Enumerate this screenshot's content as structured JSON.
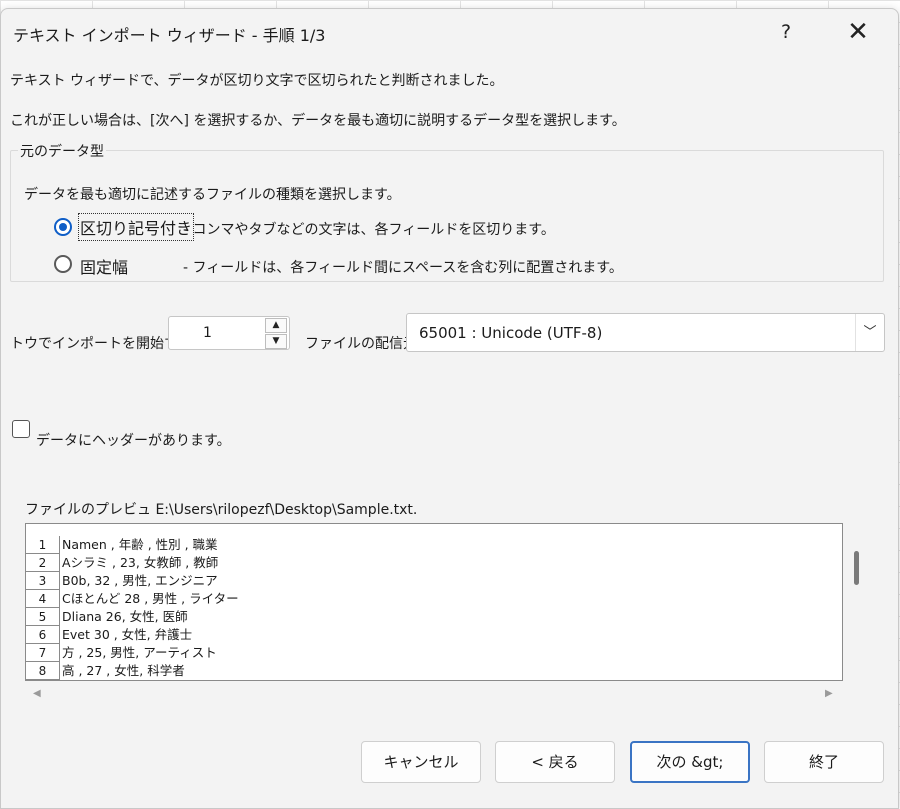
{
  "window": {
    "title": "テキスト インポート ウィザード - 手順 1/3",
    "help_label": "?",
    "close_label": "✕"
  },
  "intro": {
    "line1": "テキスト ウィザードで、データが区切り文字で区切られたと判断されました。",
    "line2": "これが正しい場合は、[次へ] を選択するか、データを最も適切に説明するデータ型を選択します。"
  },
  "original_data_type": {
    "group_title": "元のデータ型",
    "prompt": "データを最も適切に記述するファイルの種類を選択します。",
    "options": [
      {
        "label": "区切り記号付き",
        "description": "- コンマやタブなどの文字は、各フィールドを区切ります。",
        "selected": true
      },
      {
        "label": "固定幅",
        "description": "- フィールドは、各フィールド間にスペースを含む列に配置されます。",
        "selected": false
      }
    ]
  },
  "start_row": {
    "label": "トウでインポートを開始する:",
    "value": "1",
    "up_icon": "▲",
    "down_icon": "▼"
  },
  "file_origin": {
    "label": "ファイルの配信元",
    "value": "65001 : Unicode (UTF-8)",
    "dropdown_icon": "﹀"
  },
  "headers": {
    "label": "データにヘッダーがあります。",
    "checked": false
  },
  "preview": {
    "label": "ファイルのプレビュ E:\\Users\\rilopezf\\Desktop\\Sample.txt.",
    "rows": [
      {
        "num": "1",
        "text": "Namen , 年齢 , 性別 , 職業"
      },
      {
        "num": "2",
        "text": "Aシラミ , 23, 女教師 , 教師"
      },
      {
        "num": "3",
        "text": "B0b, 32 , 男性, エンジニア"
      },
      {
        "num": "4",
        "text": "Cほとんど 28 , 男性 , ライター"
      },
      {
        "num": "5",
        "text": "Dliana 26, 女性, 医師"
      },
      {
        "num": "6",
        "text": "Evet 30 , 女性, 弁護士"
      },
      {
        "num": "7",
        "text": "方 , 25, 男性, アーティスト"
      },
      {
        "num": "8",
        "text": "高 , 27 , 女性, 科学者"
      }
    ],
    "scroll_left_icon": "◀",
    "scroll_right_icon": "▶"
  },
  "buttons": {
    "cancel": "キャンセル",
    "back": "< 戻る",
    "next": "次の &gt;",
    "finish": "終了"
  },
  "colors": {
    "accent": "#0f5ec7",
    "dialog_bg": "#f3f3f3"
  }
}
